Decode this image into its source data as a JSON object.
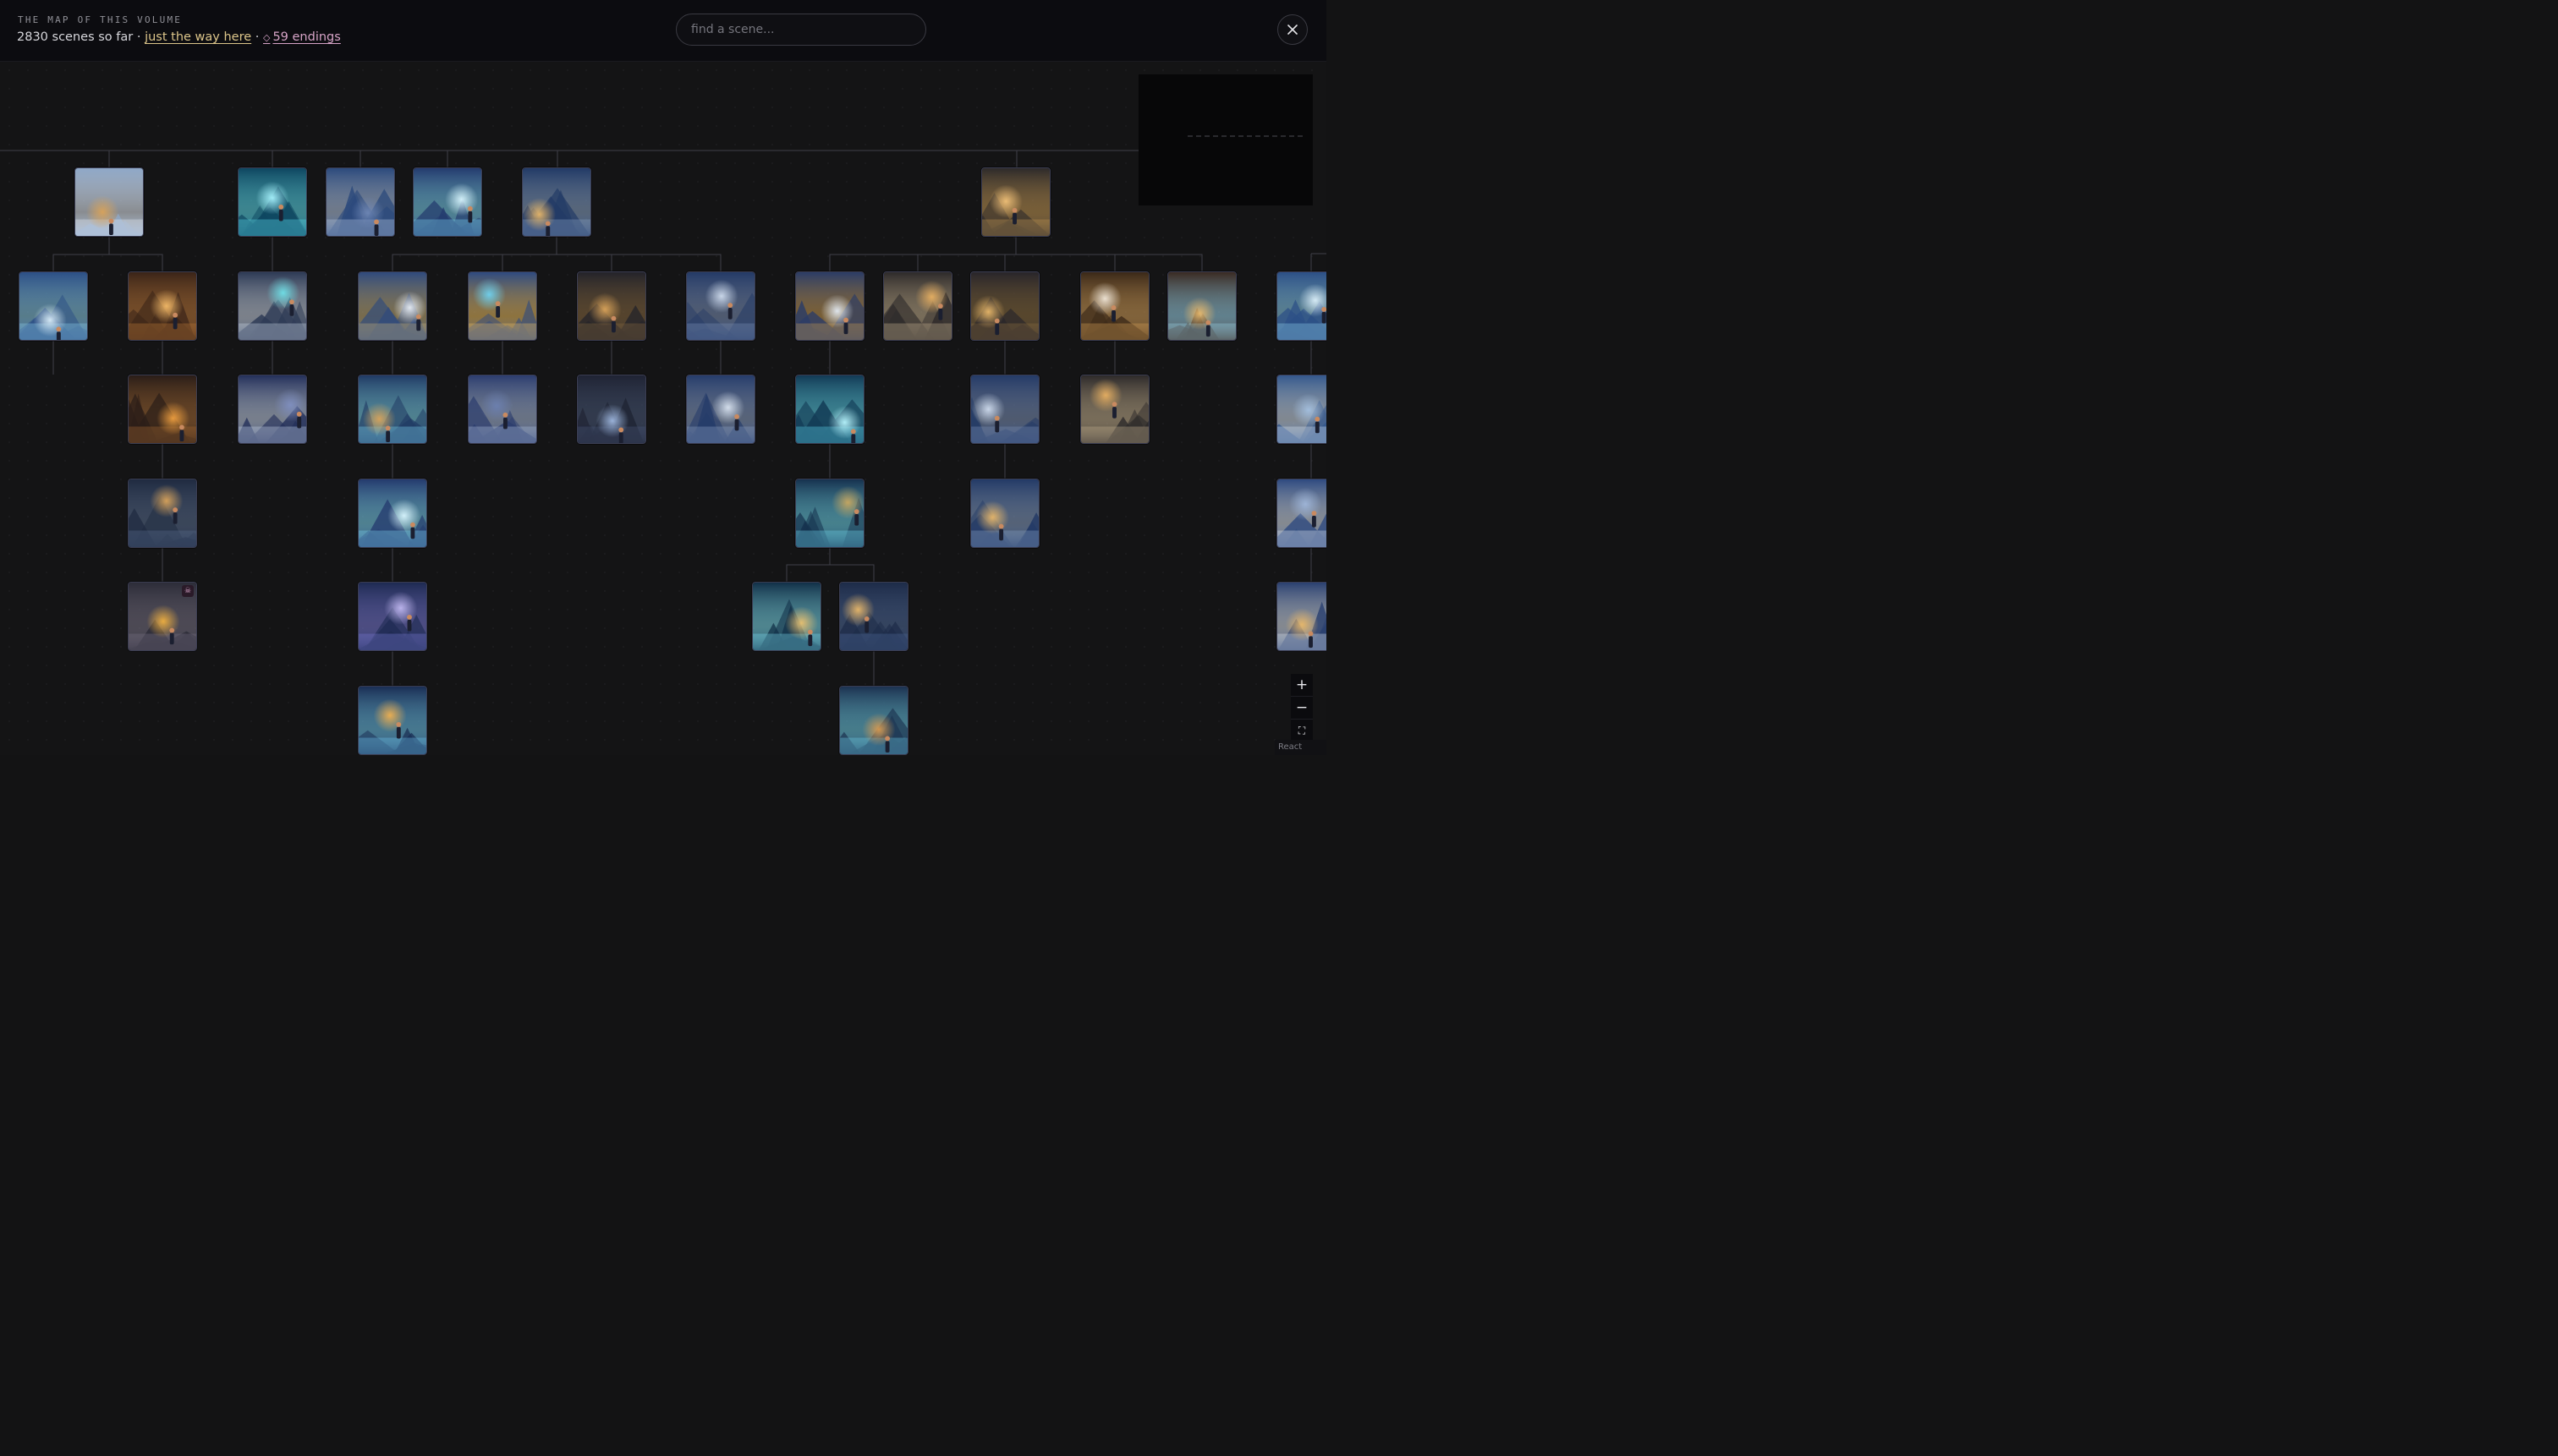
{
  "header": {
    "eyebrow": "THE MAP OF THIS VOLUME",
    "scene_count_text": "2830 scenes so far",
    "separator": "·",
    "path_link": "just the way here",
    "endings_symbol": "◇",
    "endings_link": "59 endings"
  },
  "search": {
    "placeholder": "find a scene..."
  },
  "close": {
    "icon": "close-icon"
  },
  "controls": {
    "zoom_in": "+",
    "zoom_out": "−",
    "fit_view": "⛶"
  },
  "attribution": "React Flow",
  "colors": {
    "background": "#131314",
    "header": "#0c0c10",
    "accent_gold": "#dcc58a",
    "accent_pink": "#d6a3c6",
    "edge": "#3f4049",
    "node_border": "#3b3d52"
  },
  "scenes": [
    {
      "id": "n1",
      "theme": "village"
    },
    {
      "id": "n2",
      "theme": "ice-cave"
    },
    {
      "id": "n3",
      "theme": "snow-canyon"
    },
    {
      "id": "n4",
      "theme": "crystal"
    },
    {
      "id": "n5",
      "theme": "tower"
    },
    {
      "id": "n6",
      "theme": "bell-room"
    },
    {
      "id": "n7",
      "theme": "frozen-fountain"
    },
    {
      "id": "n8",
      "theme": "cabin"
    },
    {
      "id": "n9",
      "theme": "bear-cave"
    },
    {
      "id": "n10",
      "theme": "orrery"
    },
    {
      "id": "n11",
      "theme": "magic-bell"
    },
    {
      "id": "n12",
      "theme": "stair-pit"
    },
    {
      "id": "n13",
      "theme": "bell-tower"
    },
    {
      "id": "n14",
      "theme": "bell-hole"
    },
    {
      "id": "n15",
      "theme": "bear-room"
    },
    {
      "id": "n16",
      "theme": "great-bell"
    },
    {
      "id": "n17",
      "theme": "bear-lamp"
    },
    {
      "id": "n18",
      "theme": "frozen-falls"
    },
    {
      "id": "n19",
      "theme": "frozen-fountain"
    },
    {
      "id": "n20",
      "theme": "fireplace"
    },
    {
      "id": "n21",
      "theme": "snow-valley"
    },
    {
      "id": "n22",
      "theme": "crystal-door"
    },
    {
      "id": "n23",
      "theme": "mountain-ledge"
    },
    {
      "id": "n24",
      "theme": "spiral-stair"
    },
    {
      "id": "n25",
      "theme": "bridge"
    },
    {
      "id": "n26",
      "theme": "crystal-cave"
    },
    {
      "id": "n27",
      "theme": "bell-tower"
    },
    {
      "id": "n28",
      "theme": "bear-room"
    },
    {
      "id": "n29",
      "theme": "bear-snow"
    },
    {
      "id": "n30",
      "theme": "tunnel"
    },
    {
      "id": "n31",
      "theme": "crystal"
    },
    {
      "id": "n32",
      "theme": "crystal-library"
    },
    {
      "id": "n33",
      "theme": "arch-bridge"
    },
    {
      "id": "n34",
      "theme": "bear-balcony"
    },
    {
      "id": "n35",
      "theme": "treasure",
      "ending": true
    },
    {
      "id": "n36",
      "theme": "portal-tunnel"
    },
    {
      "id": "n37",
      "theme": "ghost-book"
    },
    {
      "id": "n38",
      "theme": "library"
    },
    {
      "id": "n39",
      "theme": "bear-street"
    },
    {
      "id": "n40",
      "theme": "crystal-corridor"
    },
    {
      "id": "n41",
      "theme": "library-reader"
    }
  ]
}
